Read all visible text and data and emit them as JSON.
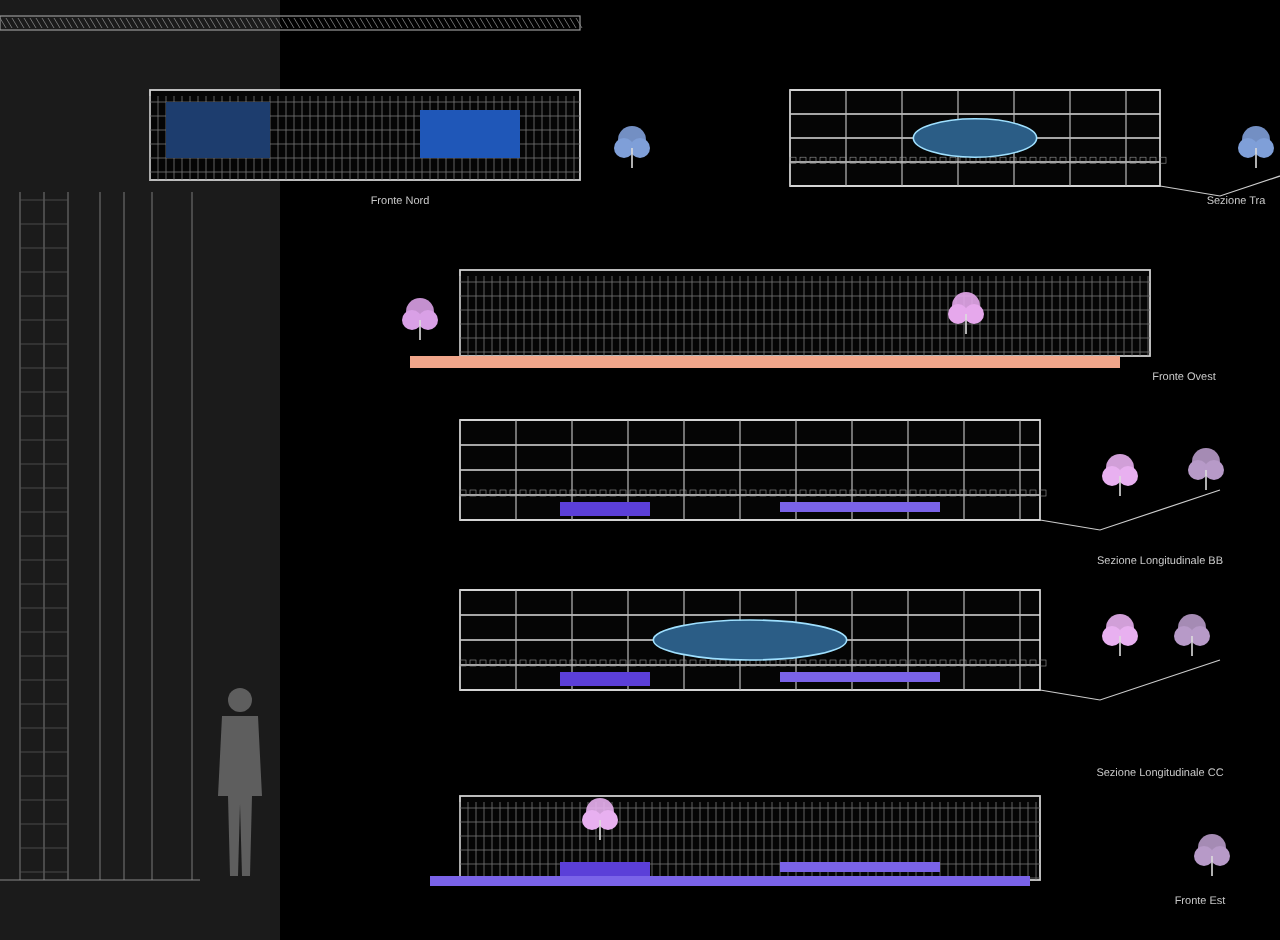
{
  "sheet": {
    "drawings": [
      {
        "kind": "elevation",
        "label": "Fronte Nord"
      },
      {
        "kind": "section",
        "label": "Sezione Tra"
      },
      {
        "kind": "elevation",
        "label": "Fronte Ovest"
      },
      {
        "kind": "section",
        "label": "Sezione Longitudinale BB"
      },
      {
        "kind": "section",
        "label": "Sezione Longitudinale CC"
      },
      {
        "kind": "elevation",
        "label": "Fronte Est"
      }
    ]
  }
}
